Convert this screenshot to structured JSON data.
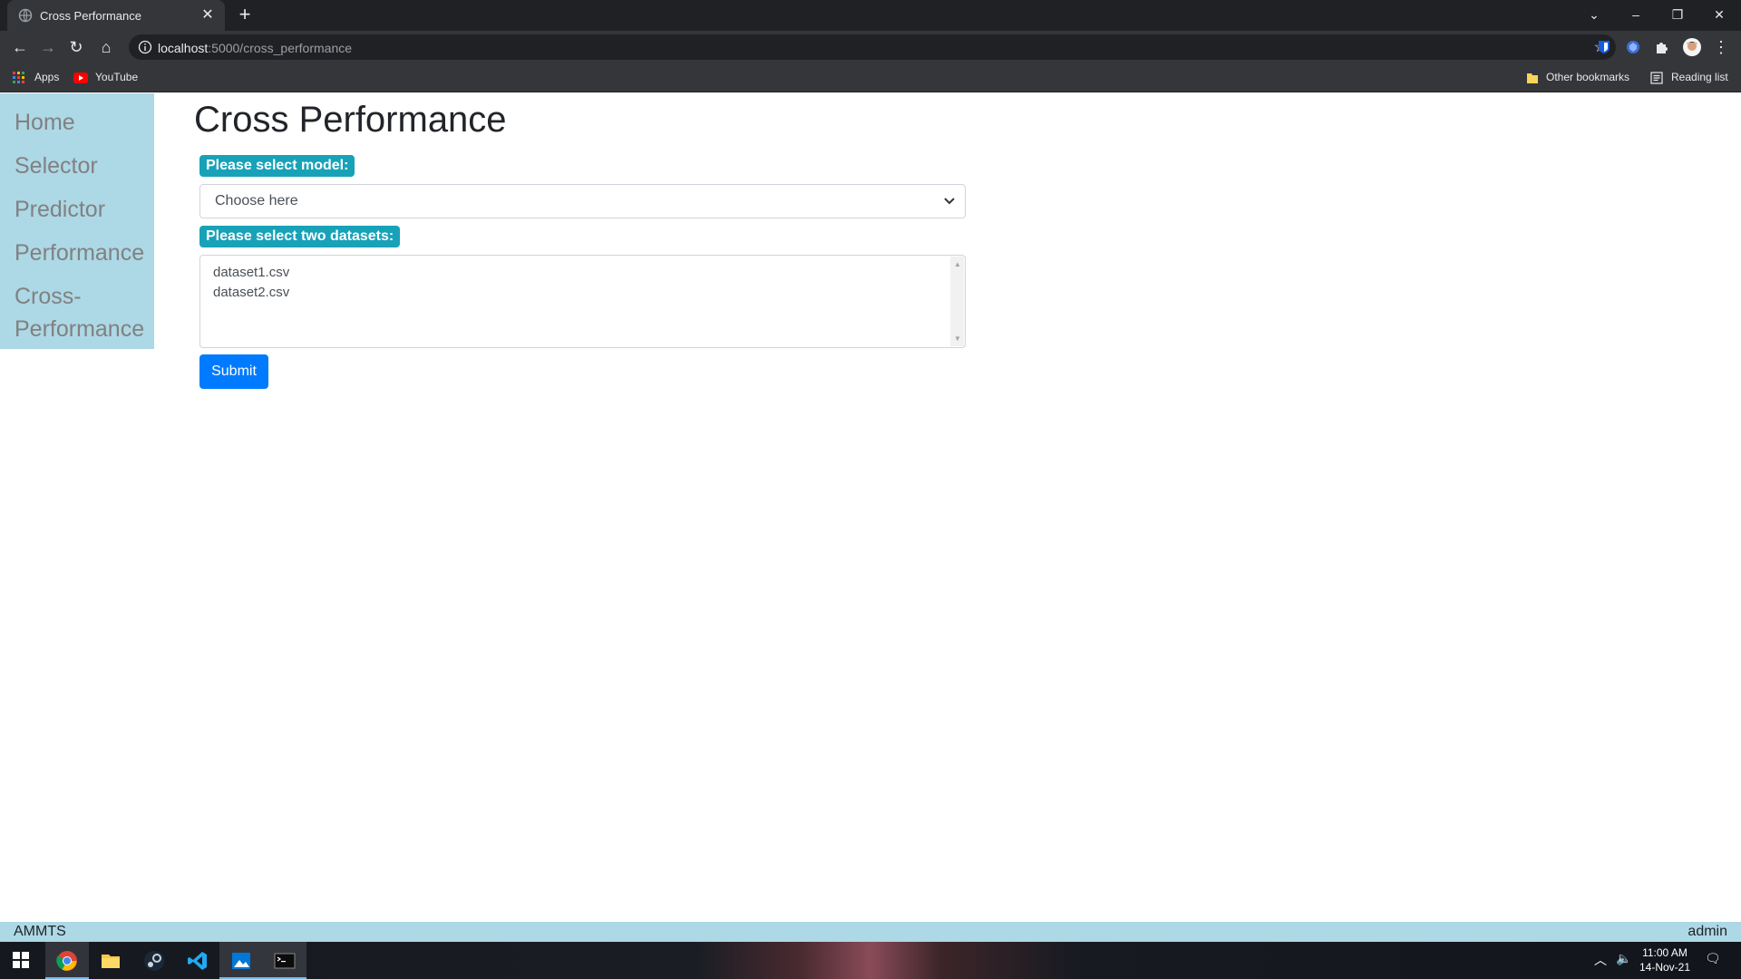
{
  "browser": {
    "tab_title": "Cross Performance",
    "url_host": "localhost",
    "url_path": ":5000/cross_performance",
    "bookmarks": {
      "apps": "Apps",
      "youtube": "YouTube",
      "other": "Other bookmarks",
      "reading_list": "Reading list"
    }
  },
  "sidebar": {
    "items": [
      {
        "label": "Home"
      },
      {
        "label": "Selector"
      },
      {
        "label": "Predictor"
      },
      {
        "label": "Performance"
      },
      {
        "label": "Cross-Performance"
      }
    ]
  },
  "main": {
    "title": "Cross Performance",
    "model_label": "Please select model:",
    "model_select_value": "Choose here",
    "datasets_label": "Please select two datasets:",
    "datasets": [
      "dataset1.csv",
      "dataset2.csv"
    ],
    "submit_label": "Submit"
  },
  "footer": {
    "left": "AMMTS",
    "right": "admin"
  },
  "taskbar": {
    "time": "11:00 AM",
    "date": "14-Nov-21"
  },
  "colors": {
    "sidebar_bg": "#add8e6",
    "badge_bg": "#17a2b8",
    "primary": "#007bff"
  }
}
